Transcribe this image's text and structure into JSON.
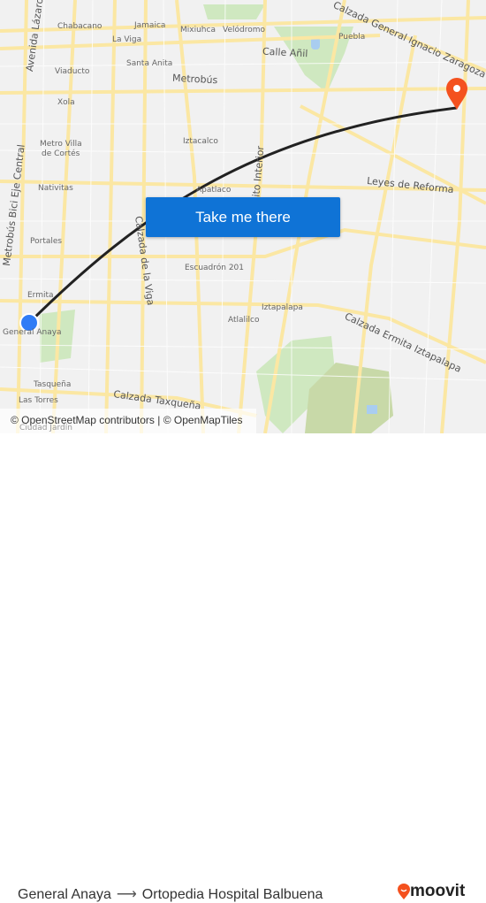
{
  "map": {
    "labels": [
      "Chabacano",
      "Jamaica",
      "La Viga",
      "Mixiuhca",
      "Velódromo",
      "Santa Anita",
      "Viaducto",
      "Metrobús",
      "Xola",
      "Metro Villa",
      "de Cortés",
      "Iztacalco",
      "Nativitas",
      "Apatlaco",
      "Portales",
      "Escuadrón 201",
      "Ermita",
      "General Anaya",
      "Iztapalapa",
      "Atlalilco",
      "Tasqueña",
      "Las Torres",
      "Calle Añil",
      "Puebla",
      "Calzada General Ignacio Zaragoza",
      "Leyes de Reforma",
      "Calzada Ermita Iztapalapa",
      "Calzada Taxqueña",
      "Avenida Lázaro Cárdenas",
      "Calzada de la Viga",
      "Circuito Interior",
      "Metrobús Bici Eje Central",
      "Ciudad Jardín"
    ],
    "origin_marker_color": "#2f7cf6",
    "destination_marker_color": "#f4511e",
    "route_color": "#222222"
  },
  "cta": {
    "label": "Take me there",
    "color": "#0f73d6"
  },
  "attribution": "© OpenStreetMap contributors | © OpenMapTiles",
  "footer": {
    "origin": "General Anaya",
    "destination": "Ortopedia Hospital Balbuena",
    "arrow_icon": "arrow-right-icon",
    "brand": "moovit",
    "brand_color": "#f4511e"
  }
}
